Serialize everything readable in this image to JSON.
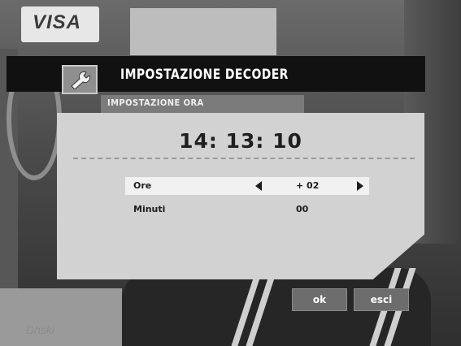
{
  "background": {
    "brand_text": "VISA",
    "bottom_text": "Dhski"
  },
  "dialog": {
    "icon": "wrench-icon",
    "title": "IMPOSTAZIONE DECODER",
    "subtitle": "IMPOSTAZIONE ORA",
    "clock": "14: 13: 10",
    "rows": [
      {
        "label": "Ore",
        "value": "+ 02"
      },
      {
        "label": "Minuti",
        "value": "00"
      }
    ],
    "buttons": {
      "ok": "ok",
      "exit": "esci"
    }
  },
  "colors": {
    "title_bar": "#111111",
    "panel": "#d2d2d2",
    "selected_row": "#f1f1f1",
    "button": "#6d6d6d"
  }
}
